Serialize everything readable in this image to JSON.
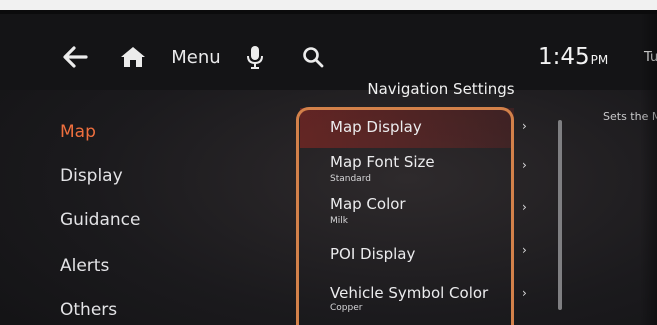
{
  "header": {
    "menu_label": "Menu",
    "clock_time": "1:45",
    "clock_ampm": "PM",
    "clock_day": "Tu"
  },
  "page": {
    "title": "Navigation Settings"
  },
  "sidebar": {
    "items": [
      {
        "label": "Map",
        "active": true
      },
      {
        "label": "Display",
        "active": false
      },
      {
        "label": "Guidance",
        "active": false
      },
      {
        "label": "Alerts",
        "active": false
      },
      {
        "label": "Others",
        "active": false
      }
    ]
  },
  "settings_list": [
    {
      "label": "Map Display",
      "value": "",
      "selected": true
    },
    {
      "label": "Map Font Size",
      "value": "Standard"
    },
    {
      "label": "Map Color",
      "value": "Milk"
    },
    {
      "label": "POI Display",
      "value": ""
    },
    {
      "label": "Vehicle Symbol Color",
      "value": "Copper"
    }
  ],
  "description": {
    "text": "Sets the M"
  },
  "colors": {
    "active_menu": "#ef6f3e",
    "highlight_frame": "#d3814a",
    "background": "#1b1a1d"
  },
  "icons": [
    "back-arrow-icon",
    "home-icon",
    "microphone-icon",
    "search-icon",
    "chevron-right-icon"
  ]
}
